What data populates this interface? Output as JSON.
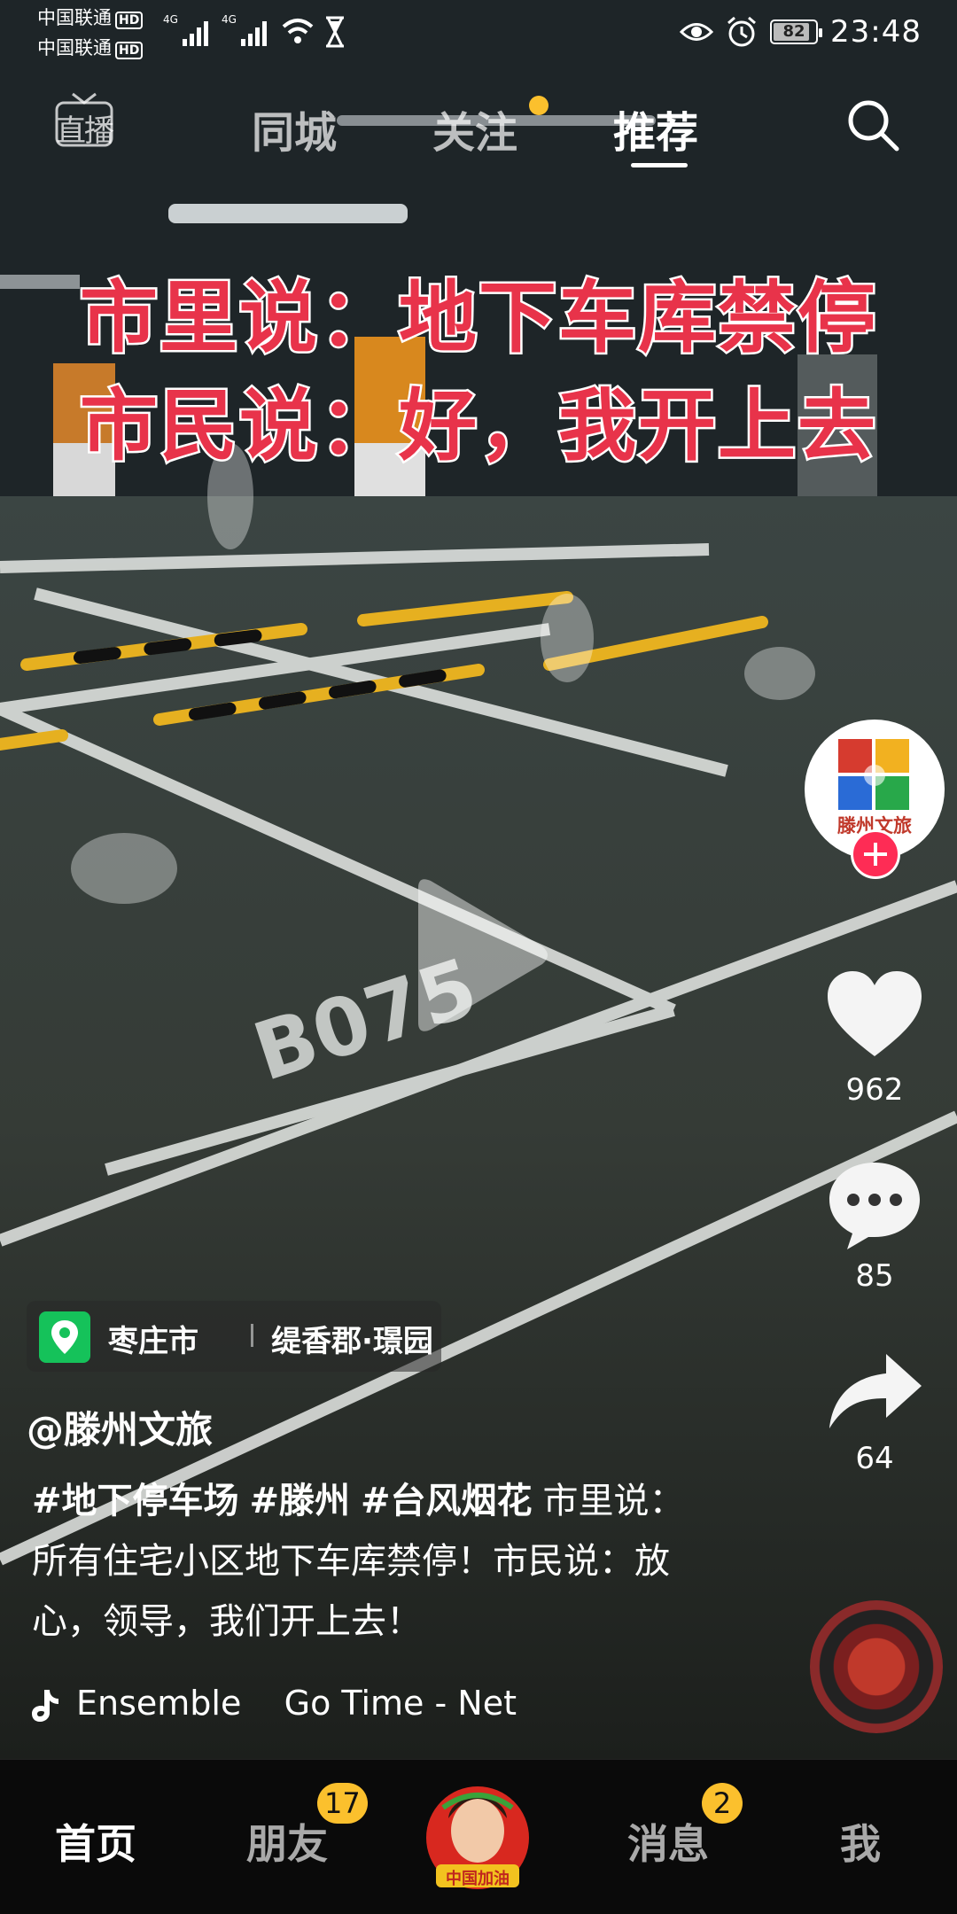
{
  "status_bar": {
    "carrier1": "中国联通",
    "carrier2": "中国联通",
    "hd_label": "HD",
    "network1": "4G",
    "network2": "4G",
    "battery": "82",
    "time": "23:48"
  },
  "top_nav": {
    "live_label": "直播",
    "tabs": [
      "同城",
      "关注",
      "推荐"
    ],
    "active_tab": "推荐"
  },
  "video": {
    "headline_line1": "市里说：地下车库禁停",
    "headline_line2": "市民说：好，我开上去",
    "floor_marking": "B075"
  },
  "author_avatar_label": "滕州文旅",
  "actions": {
    "likes": "962",
    "comments": "85",
    "shares": "64"
  },
  "location": {
    "city": "枣庄市",
    "place": "缇香郡·璟园"
  },
  "author": "@滕州文旅",
  "description": {
    "tags": [
      "#地下停车场",
      "#滕州",
      "#台风烟花"
    ],
    "text": "市里说：所有住宅小区地下车库禁停！市民说：放心，领导，我们开上去！"
  },
  "music": "Ensemble    Go Time - Net",
  "bottom_nav": {
    "home": "首页",
    "friends": "朋友",
    "friends_badge": "17",
    "messages": "消息",
    "messages_badge": "2",
    "me": "我",
    "center_label": "中国加油"
  },
  "colors": {
    "accent_red": "#fe2c55",
    "badge_yellow": "#fbc02d",
    "location_green": "#15c25a",
    "headline_red": "#e8334a"
  }
}
